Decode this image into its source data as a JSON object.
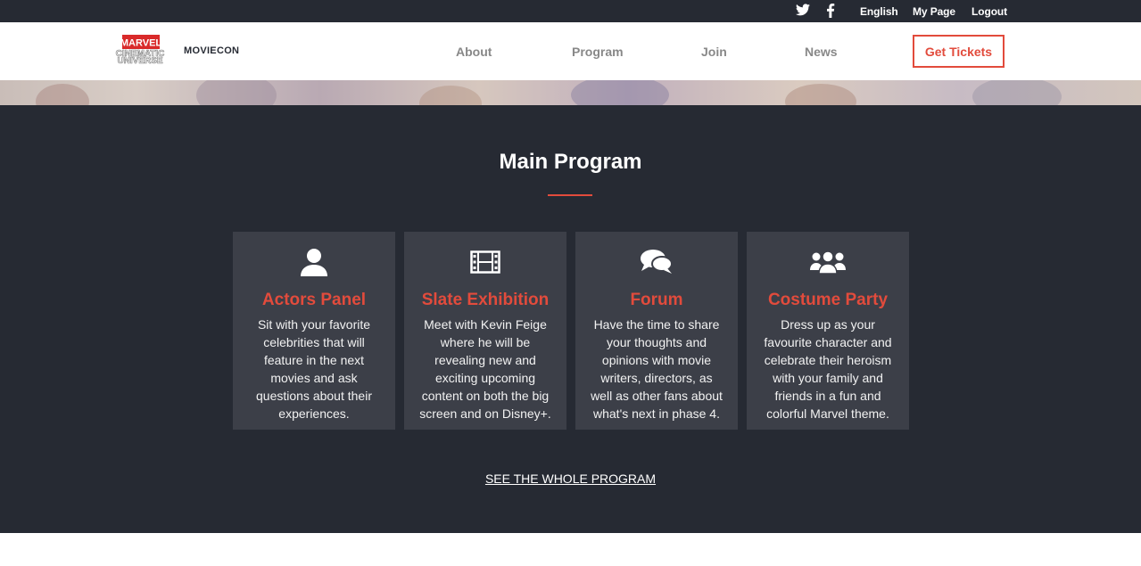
{
  "topbar": {
    "social": [
      {
        "name": "twitter-icon"
      },
      {
        "name": "facebook-icon"
      }
    ],
    "language": "English",
    "my_page": "My Page",
    "logout": "Logout"
  },
  "header": {
    "logo": {
      "top": "MARVEL",
      "line1": "CINEMATIC",
      "line2": "UNIVERSE"
    },
    "brand": "MOVIECON",
    "nav": [
      "About",
      "Program",
      "Join",
      "News"
    ],
    "cta": "Get Tickets"
  },
  "colors": {
    "accent": "#e24b3c",
    "dark_bg": "#262a33",
    "card_bg": "#3c3f48"
  },
  "program": {
    "title": "Main Program",
    "cards": [
      {
        "icon": "user-icon",
        "title": "Actors Panel",
        "text": "Sit with your favorite celebrities that will feature in the next movies and ask questions about their experiences."
      },
      {
        "icon": "film-icon",
        "title": "Slate Exhibition",
        "text": "Meet with Kevin Feige where he will be revealing new and exciting upcoming content on both the big screen and on Disney+."
      },
      {
        "icon": "chat-bubbles-icon",
        "title": "Forum",
        "text": "Have the time to share your thoughts and opinions with movie writers, directors, as well as other fans about what's next in phase 4."
      },
      {
        "icon": "group-icon",
        "title": "Costume Party",
        "text": "Dress up as your favourite character and celebrate their heroism with your family and friends in a fun and colorful Marvel theme."
      }
    ],
    "see_all": "SEE THE WHOLE PROGRAM"
  }
}
